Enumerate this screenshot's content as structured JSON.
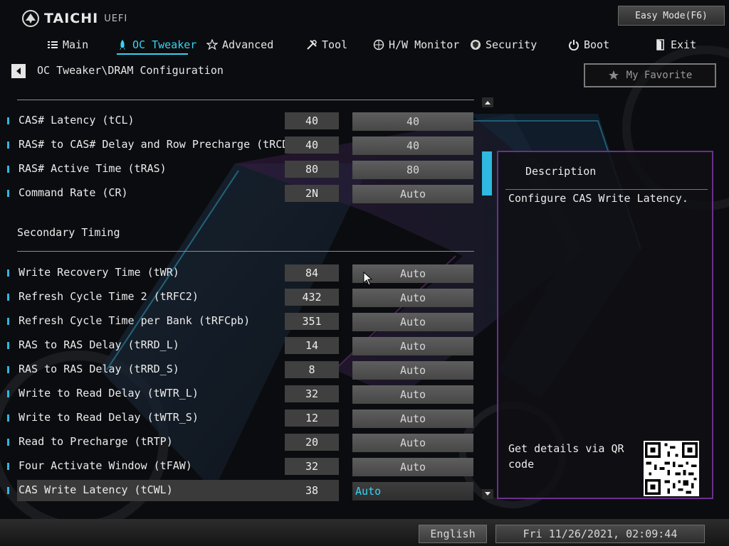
{
  "header": {
    "brand": "TAICHI",
    "brand_sub": "UEFI",
    "easy_mode_label": "Easy Mode(F6)"
  },
  "nav": {
    "tabs": [
      {
        "label": "Main",
        "icon": "list-icon"
      },
      {
        "label": "OC Tweaker",
        "icon": "rocket-icon",
        "active": true
      },
      {
        "label": "Advanced",
        "icon": "star-icon"
      },
      {
        "label": "Tool",
        "icon": "tools-icon"
      },
      {
        "label": "H/W Monitor",
        "icon": "monitor-icon"
      },
      {
        "label": "Security",
        "icon": "shield-icon"
      },
      {
        "label": "Boot",
        "icon": "power-icon"
      },
      {
        "label": "Exit",
        "icon": "exit-icon"
      }
    ]
  },
  "breadcrumb": "OC Tweaker\\DRAM Configuration",
  "favorite_label": "My Favorite",
  "primary_rows": [
    {
      "label": "CAS# Latency (tCL)",
      "current": "40",
      "setting": "40"
    },
    {
      "label": "RAS# to CAS# Delay and Row Precharge (tRCDtRP)",
      "current": "40",
      "setting": "40"
    },
    {
      "label": "RAS# Active Time (tRAS)",
      "current": "80",
      "setting": "80"
    },
    {
      "label": "Command Rate (CR)",
      "current": "2N",
      "setting": "Auto"
    }
  ],
  "secondary_title": "Secondary Timing",
  "secondary_rows": [
    {
      "label": "Write Recovery Time (tWR)",
      "current": "84",
      "setting": "Auto"
    },
    {
      "label": "Refresh Cycle Time 2 (tRFC2)",
      "current": "432",
      "setting": "Auto"
    },
    {
      "label": "Refresh Cycle Time per Bank (tRFCpb)",
      "current": "351",
      "setting": "Auto"
    },
    {
      "label": "RAS to RAS Delay (tRRD_L)",
      "current": "14",
      "setting": "Auto"
    },
    {
      "label": "RAS to RAS Delay (tRRD_S)",
      "current": "8",
      "setting": "Auto"
    },
    {
      "label": "Write to Read Delay (tWTR_L)",
      "current": "32",
      "setting": "Auto"
    },
    {
      "label": "Write to Read Delay (tWTR_S)",
      "current": "12",
      "setting": "Auto"
    },
    {
      "label": "Read to Precharge (tRTP)",
      "current": "20",
      "setting": "Auto"
    },
    {
      "label": "Four Activate Window (tFAW)",
      "current": "32",
      "setting": "Auto"
    },
    {
      "label": "CAS Write Latency (tCWL)",
      "current": "38",
      "setting": "Auto",
      "selected": true
    }
  ],
  "description": {
    "title": "Description",
    "text": "Configure CAS Write Latency.",
    "qr_text": "Get details via QR code"
  },
  "footer": {
    "language": "English",
    "datetime": "Fri 11/26/2021, 02:09:44"
  },
  "colors": {
    "accent": "#36d3f3",
    "panel_border": "#6c2f8d"
  }
}
